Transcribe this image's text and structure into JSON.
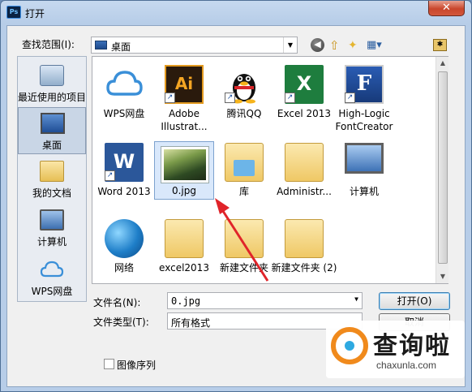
{
  "window": {
    "title": "打开",
    "app_icon": "Ps",
    "close_glyph": "✕"
  },
  "toolbar": {
    "look_in_label": "查找范围(I):",
    "look_in_value": "桌面",
    "back_glyph": "◀",
    "up_glyph": "⇧",
    "new_folder_glyph": "✦",
    "view_glyph": "▦▾",
    "extra_glyph": "✱"
  },
  "places": [
    {
      "label": "最近使用的项目",
      "icon": "recent-places-icon"
    },
    {
      "label": "桌面",
      "icon": "desktop-icon",
      "selected": true
    },
    {
      "label": "我的文档",
      "icon": "documents-folder-icon"
    },
    {
      "label": "计算机",
      "icon": "computer-icon"
    },
    {
      "label": "WPS网盘",
      "icon": "cloud-icon"
    }
  ],
  "files": [
    {
      "label": "WPS网盘",
      "icon": "cloud-icon"
    },
    {
      "label": "Adobe Illustrat...",
      "icon": "illustrator-icon",
      "glyph": "Ai",
      "shortcut": true
    },
    {
      "label": "腾讯QQ",
      "icon": "qq-penguin-icon",
      "shortcut": true
    },
    {
      "label": "Excel 2013",
      "icon": "excel-icon",
      "glyph": "X",
      "shortcut": true
    },
    {
      "label": "High-Logic FontCreator",
      "icon": "fontcreator-icon",
      "glyph": "F",
      "shortcut": true
    },
    {
      "label": "Word 2013",
      "icon": "word-icon",
      "glyph": "W",
      "shortcut": true
    },
    {
      "label": "0.jpg",
      "icon": "image-thumbnail-icon",
      "selected": true
    },
    {
      "label": "库",
      "icon": "library-folder-icon"
    },
    {
      "label": "Administr...",
      "icon": "user-folder-icon"
    },
    {
      "label": "计算机",
      "icon": "computer-icon"
    },
    {
      "label": "网络",
      "icon": "network-globe-icon"
    },
    {
      "label": "excel2013",
      "icon": "folder-icon"
    },
    {
      "label": "新建文件夹",
      "icon": "folder-icon"
    },
    {
      "label": "新建文件夹 (2)",
      "icon": "folder-icon"
    }
  ],
  "form": {
    "file_name_label": "文件名(N):",
    "file_name_value": "0.jpg",
    "file_type_label": "文件类型(T):",
    "file_type_value": "所有格式",
    "open_button": "打开(O)",
    "cancel_button": "取消",
    "image_sequence_label": "图像序列"
  },
  "watermark": {
    "title": "查询啦",
    "url": "chaxunla.com"
  },
  "colors": {
    "annotation_arrow": "#e0242a",
    "watermark_orange": "#f08a1c",
    "watermark_blue": "#2ea9e1"
  }
}
